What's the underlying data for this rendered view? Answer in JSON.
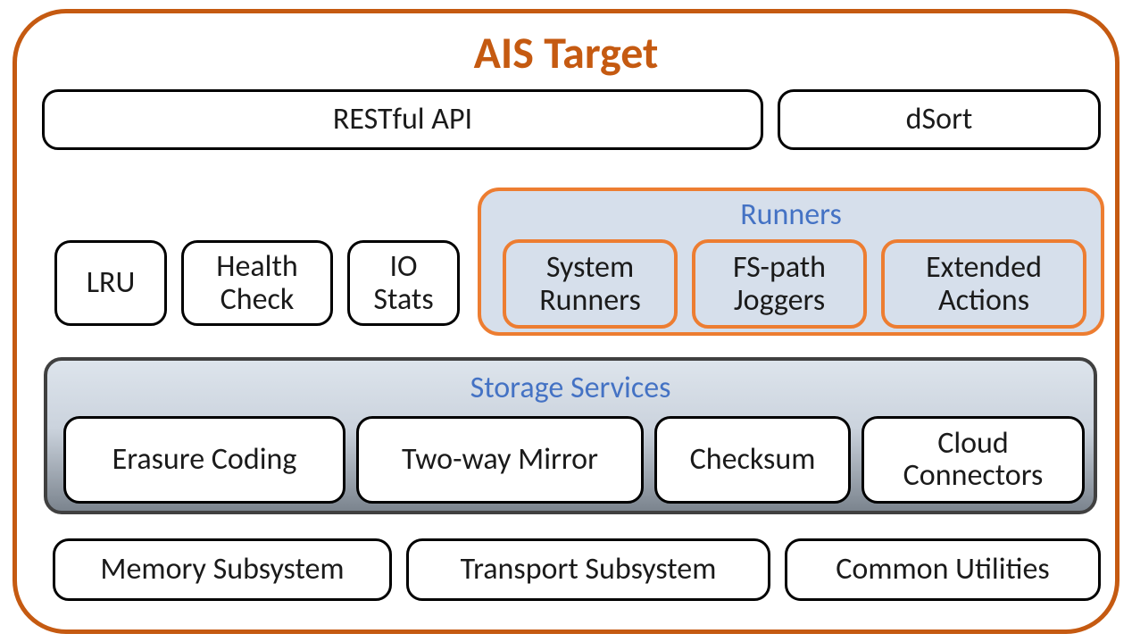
{
  "title": "AIS Target",
  "top": {
    "restful": "RESTful API",
    "dsort": "dSort"
  },
  "row2": {
    "lru": "LRU",
    "health": "Health\nCheck",
    "iostats": "IO\nStats"
  },
  "runners": {
    "title": "Runners",
    "system": "System\nRunners",
    "fspath": "FS-path\nJoggers",
    "extended": "Extended\nActions"
  },
  "storage": {
    "title": "Storage Services",
    "erasure": "Erasure Coding",
    "mirror": "Two-way Mirror",
    "checksum": "Checksum",
    "cloud": "Cloud\nConnectors"
  },
  "bottom": {
    "memory": "Memory Subsystem",
    "transport": "Transport Subsystem",
    "common": "Common Utilities"
  },
  "colors": {
    "accent": "#C55A11",
    "runnerBorder": "#ED7D31",
    "runnerFill": "#D6DFEB",
    "sectionTitle": "#4472C4"
  }
}
